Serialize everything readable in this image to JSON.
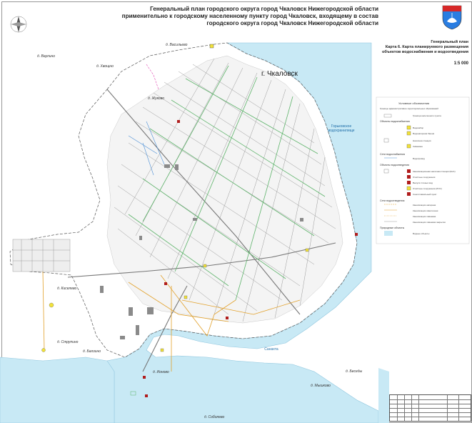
{
  "title": {
    "lines": [
      "Генеральный план городского округа город Чкаловск Нижегородской области",
      "применительно к городскому населенному пункту город Чкаловск, входящему в состав",
      "городского округа город Чкаловск Нижегородской области"
    ]
  },
  "sheet": {
    "plan_name": "Генеральный план",
    "map_name_1": "Карта 6. Карта планируемого размещения",
    "map_name_2": "объектов водоснабжения и водоотведения",
    "scale": "1:5 000"
  },
  "places": {
    "city": "г. Чкаловск",
    "vasilyovo": "д. Васильево",
    "vaulino": "д. Ваулино",
    "khvoshno": "д. Хвощно",
    "zhukovo": "д. Жуково",
    "kiselevo": "д. Киселево",
    "strupino": "д. Струпино",
    "baltsino": "д. Балзино",
    "ionovo": "д. Ионово",
    "myshkovo": "д. Мышково",
    "besedy": "д. Беседы",
    "sobolevo": "д. Соболево"
  },
  "water": {
    "reservoir_1": "Горьковское",
    "reservoir_2": "водохранилище",
    "sanakhta": "Санахта"
  },
  "legend": {
    "heading": "Условные обозначения",
    "boundary_heading": "Границы административно-территориальных образований",
    "boundary_item": "Граница населенного пункта",
    "supply_heading": "Объекты водоснабжения",
    "supply_items": [
      "Водозабор",
      "Водонапорная башня",
      "Насосная станция",
      "Скважина"
    ],
    "supply_net_heading": "Сети водоснабжения",
    "supply_net_item": "Водопровод",
    "sewer_heading": "Объекты водоотведения",
    "sewer_items": [
      "Канализационная насосная станция (КНС)",
      "Очистные сооружения",
      "Выпуск сточных вод",
      "Очистные сооружения (ЛОС)",
      "Снегоплавильный пункт"
    ],
    "sewer_net_heading": "Сети водоотведения",
    "sewer_net_items": [
      "Канализация напорная",
      "Канализация самотечная",
      "Канализация ливневая",
      "Канализация ливневая закрытая"
    ],
    "nature_heading": "Природные объекты",
    "nature_item": "Водные объекты"
  },
  "colors": {
    "water": "#c8e9f5",
    "water_line": "#8fc6de",
    "road": "#ffffff",
    "road_edge": "#9a9a9a",
    "supply_line": "#5db36a",
    "sewer_line": "#e2a12b",
    "boundary": "#e040b0",
    "building": "#8a8a8a",
    "symbol_red": "#b01c1c",
    "symbol_yellow": "#f2e23a"
  }
}
